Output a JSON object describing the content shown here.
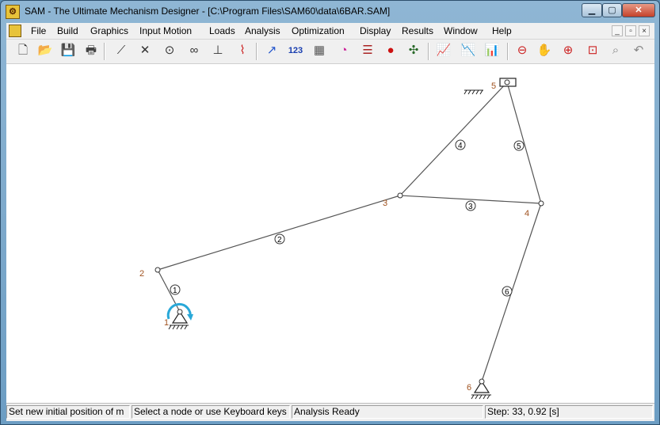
{
  "window": {
    "title": "SAM - The Ultimate Mechanism Designer - [C:\\Program Files\\SAM60\\data\\6BAR.SAM]",
    "app_icon_glyph": "⚙",
    "minimize_glyph": "▁",
    "maximize_glyph": "▢",
    "close_glyph": "✕"
  },
  "menubar": {
    "items": [
      "File",
      "Build",
      "Graphics",
      "Input Motion",
      "Loads",
      "Analysis",
      "Optimization",
      "Display",
      "Results",
      "Window",
      "Help"
    ],
    "mdi_minimize": "_",
    "mdi_restore": "▫",
    "mdi_close": "×"
  },
  "toolbar": {
    "icons": [
      {
        "name": "new-file-icon",
        "glyph": "🗋",
        "color": "#333333"
      },
      {
        "name": "open-folder-icon",
        "glyph": "📂",
        "color": "#c9a020"
      },
      {
        "name": "save-disk-icon",
        "glyph": "💾",
        "color": "#223355"
      },
      {
        "name": "print-icon",
        "glyph": "🖶",
        "color": "#444444"
      },
      {
        "name": "beam-element-icon",
        "glyph": "⟋",
        "color": "#333333"
      },
      {
        "name": "slider-element-icon",
        "glyph": "✕",
        "color": "#333333"
      },
      {
        "name": "gear-element-icon",
        "glyph": "⊙",
        "color": "#333333"
      },
      {
        "name": "belt-element-icon",
        "glyph": "∞",
        "color": "#333333"
      },
      {
        "name": "fixed-support-icon",
        "glyph": "⊥",
        "color": "#333333"
      },
      {
        "name": "spring-element-icon",
        "glyph": "⌇",
        "color": "#cc2222"
      },
      {
        "name": "motion-curve-icon",
        "glyph": "↗",
        "color": "#2255cc"
      },
      {
        "name": "numeric-input-icon",
        "glyph": "123",
        "color": "#1a3fb0"
      },
      {
        "name": "table-input-icon",
        "glyph": "▦",
        "color": "#555555"
      },
      {
        "name": "angle-input-icon",
        "glyph": "◔",
        "color": "#cc2299"
      },
      {
        "name": "ladder-icon",
        "glyph": "☰",
        "color": "#aa2222"
      },
      {
        "name": "load-pin-icon",
        "glyph": "●",
        "color": "#cc1111"
      },
      {
        "name": "windmill-icon",
        "glyph": "✣",
        "color": "#2a6a2a"
      },
      {
        "name": "graph-results-icon",
        "glyph": "📈",
        "color": "#4444aa"
      },
      {
        "name": "graph-results-2-icon",
        "glyph": "📉",
        "color": "#4444aa"
      },
      {
        "name": "graph-results-3-icon",
        "glyph": "📊",
        "color": "#4444aa"
      },
      {
        "name": "zoom-out-icon",
        "glyph": "⊖",
        "color": "#cc2222"
      },
      {
        "name": "pan-hand-icon",
        "glyph": "✋",
        "color": "#cc2222"
      },
      {
        "name": "zoom-in-icon",
        "glyph": "⊕",
        "color": "#cc2222"
      },
      {
        "name": "zoom-fit-icon",
        "glyph": "⊡",
        "color": "#cc2222"
      },
      {
        "name": "zoom-window-icon",
        "glyph": "⌕",
        "color": "#888888"
      },
      {
        "name": "undo-icon",
        "glyph": "↶",
        "color": "#888888"
      }
    ]
  },
  "canvas": {
    "node_labels": [
      "1",
      "2",
      "3",
      "4",
      "5",
      "6"
    ],
    "link_labels": [
      "1",
      "2",
      "3",
      "4",
      "5",
      "6"
    ],
    "link_color": "#555555",
    "node_label_color": "#a0521f",
    "motion_arrow_color": "#29a8d8"
  },
  "statusbar": {
    "panel1": "Set new initial position of m",
    "panel2": "Select a node or use Keyboard keys",
    "panel3": "Analysis Ready",
    "panel4": "Step: 33,     0.92 [s]"
  }
}
